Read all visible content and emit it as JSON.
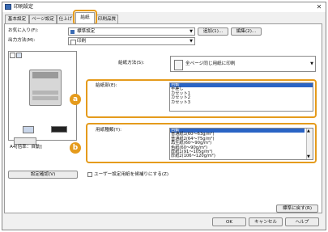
{
  "window": {
    "title": "印刷設定",
    "close_glyph": "✕"
  },
  "tabs": [
    {
      "label": "基本設定"
    },
    {
      "label": "ページ設定"
    },
    {
      "label": "仕上げ"
    },
    {
      "label": "給紙"
    },
    {
      "label": "印刷品質"
    }
  ],
  "favorites": {
    "label": "お気に入り(F):",
    "value": "標準設定",
    "add_button": "追加(1)...",
    "edit_button": "編集(2)..."
  },
  "output": {
    "label": "出力方法(M):",
    "value": "印刷"
  },
  "preview": {
    "caption": "A4[倍率：自動]"
  },
  "paper_source_method": {
    "label": "給紙方法(S):",
    "value": "全ページ同じ用紙に印刷"
  },
  "paper_source": {
    "label": "給紙部(E):",
    "items": [
      "自動",
      "手差し",
      "カセット1",
      "カセット2",
      "カセット3"
    ],
    "selected_index": 0,
    "marker": "a"
  },
  "paper_type": {
    "label": "用紙種類(Y):",
    "items": [
      "自動",
      "普通紙1(60～63g/m²)",
      "普通紙2(64～75g/m²)",
      "再生紙(60～90g/m²)",
      "色紙(60～90g/m²)",
      "厚紙1(91～105g/m²)",
      "厚紙2(106～120g/m²)"
    ],
    "selected_index": 0,
    "marker": "b"
  },
  "settings_confirm_button": "設定確認(V)",
  "user_paper_checkbox": {
    "label": "ユーザー設定用紙を候補りにする(Z)",
    "checked": false
  },
  "restore_default_button": "標準に戻す(R)",
  "ok_button": "OK",
  "cancel_button": "キャンセル",
  "help_button": "ヘルプ",
  "colors": {
    "accent": "#e59b1c",
    "selection": "#2a64c5"
  }
}
